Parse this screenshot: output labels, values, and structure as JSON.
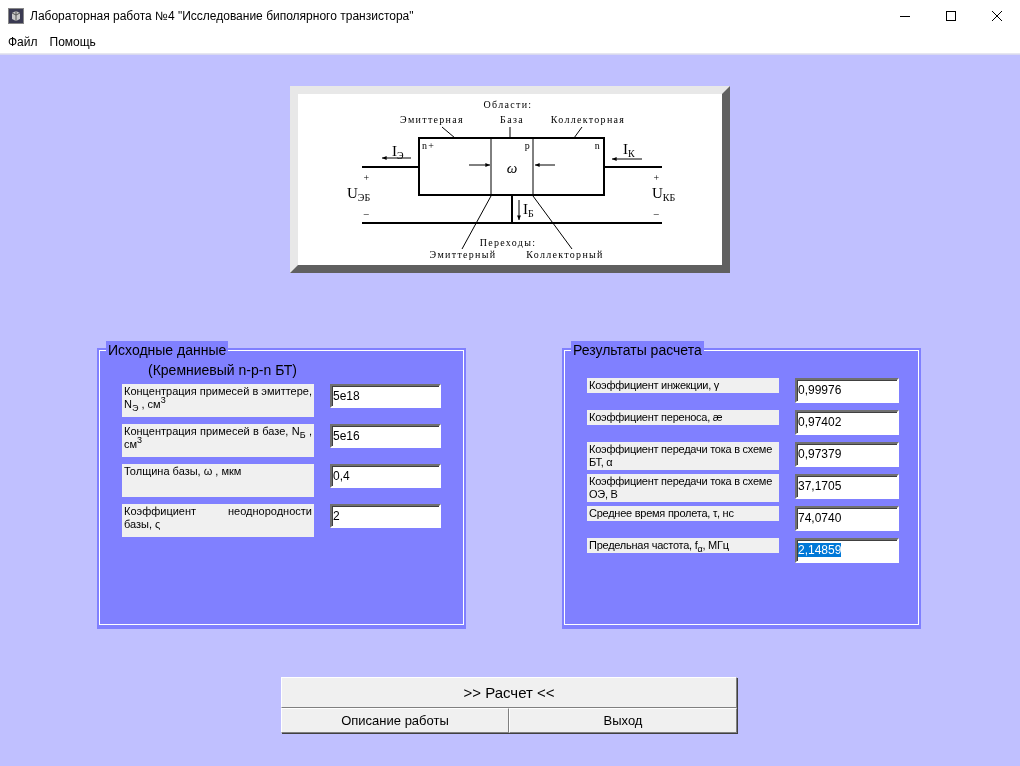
{
  "window": {
    "title": "Лабораторная работа №4 \"Исследование биполярного транзистора\""
  },
  "menu": [
    {
      "label": "Файл"
    },
    {
      "label": "Помощь"
    }
  ],
  "diagram": {
    "regions_heading": "Области:",
    "regions": [
      "Эмиттерная",
      "База",
      "Коллекторная"
    ],
    "types": [
      "n+",
      "p",
      "n"
    ],
    "currents": [
      {
        "main": "I",
        "sub": "Э"
      },
      {
        "main": "I",
        "sub": "К"
      },
      {
        "main": "I",
        "sub": "Б"
      }
    ],
    "voltages": [
      {
        "main": "U",
        "sub": "ЭБ"
      },
      {
        "main": "U",
        "sub": "КБ"
      }
    ],
    "polarities": [
      "+",
      "+",
      "–",
      "–"
    ],
    "width_symbol": "ω",
    "junctions_heading": "Переходы:",
    "junctions": [
      "Эмиттерный",
      "Коллекторный"
    ]
  },
  "input_panel": {
    "title": "Исходные данные",
    "subtitle": "(Кремниевый n-p-n БТ)",
    "fields": [
      {
        "label": "Концентрация примесей в эмиттере, N$_{Э}$ , см$^{3}$",
        "value": "5e18",
        "selected": false
      },
      {
        "label": "Концентрация примесей в базе, N$_{Б}$ , см$^{3}$",
        "value": "5e16",
        "selected": false
      },
      {
        "label": "Толщина базы, ω , мкм",
        "value": "0,4",
        "selected": false
      },
      {
        "label": "Коэффициент неоднородности базы, ς",
        "value": "2",
        "selected": false
      }
    ]
  },
  "results_panel": {
    "title": "Результаты расчета",
    "fields": [
      {
        "label": "Коэффициент инжекции, γ",
        "value": "0,99976",
        "selected": false
      },
      {
        "label": "Коэффициент переноса, æ",
        "value": "0,97402",
        "selected": false
      },
      {
        "label": "Коэффициент передачи тока в схеме БТ, α",
        "value": "0,97379",
        "selected": false
      },
      {
        "label": "Коэффициент передачи тока в схеме ОЭ, В",
        "value": "37,1705",
        "selected": false
      },
      {
        "label": "Среднее время пролета, τ, нс",
        "value": "74,0740",
        "selected": false
      },
      {
        "label": "Предельная частота, f$_{α}$, МГц",
        "value": "2,14859",
        "selected": true
      }
    ]
  },
  "buttons": {
    "calculate": ">> Расчет <<",
    "bottom": [
      "Описание работы",
      "Выход"
    ]
  }
}
